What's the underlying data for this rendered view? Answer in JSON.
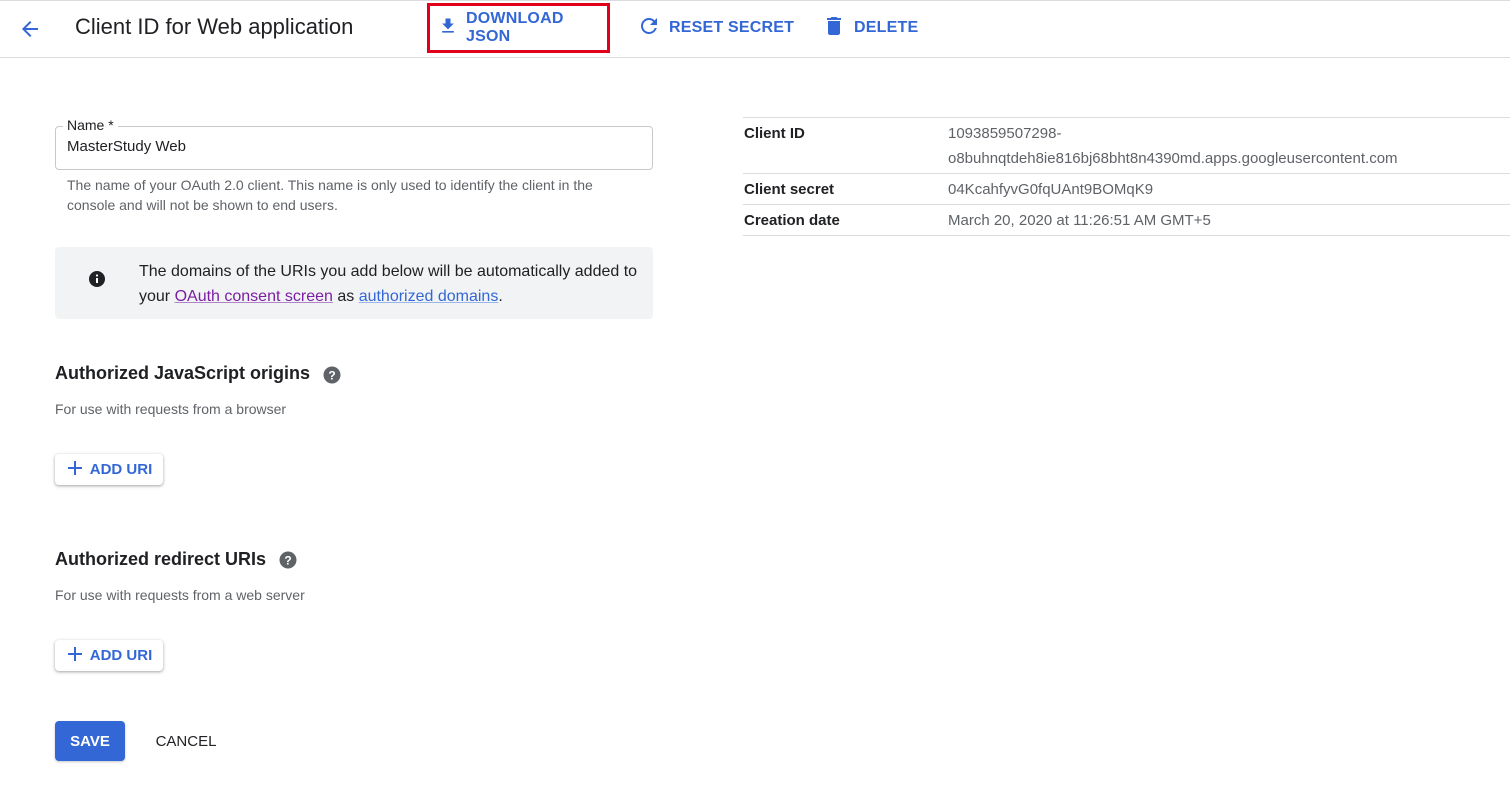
{
  "header": {
    "title": "Client ID for Web application",
    "actions": {
      "download": "DOWNLOAD JSON",
      "reset": "RESET SECRET",
      "delete": "DELETE"
    }
  },
  "form": {
    "name_label": "Name *",
    "name_value": "MasterStudy Web",
    "name_hint": "The name of your OAuth 2.0 client. This name is only used to identify the client in the console and will not be shown to end users."
  },
  "info": {
    "text_before": "The domains of the URIs you add below will be automatically added to your ",
    "link1": "OAuth consent screen",
    "text_middle": " as ",
    "link2": "authorized domains",
    "text_after": "."
  },
  "js_origins": {
    "title": "Authorized JavaScript origins",
    "subtitle": "For use with requests from a browser",
    "add_label": "ADD URI"
  },
  "redirect_uris": {
    "title": "Authorized redirect URIs",
    "subtitle": "For use with requests from a web server",
    "add_label": "ADD URI"
  },
  "footer": {
    "save": "SAVE",
    "cancel": "CANCEL"
  },
  "details": [
    {
      "label": "Client ID",
      "value_line1": "1093859507298-",
      "value_line2": "o8buhnqtdeh8ie816bj68bht8n4390md.apps.googleusercontent.com"
    },
    {
      "label": "Client secret",
      "value": "04KcahfyvG0fqUAnt9BOMqK9"
    },
    {
      "label": "Creation date",
      "value": "March 20, 2020 at 11:26:51 AM GMT+5"
    }
  ],
  "colors": {
    "accent": "#3367d6",
    "highlight_box": "#e0001b",
    "info_bg": "#f1f3f4"
  }
}
